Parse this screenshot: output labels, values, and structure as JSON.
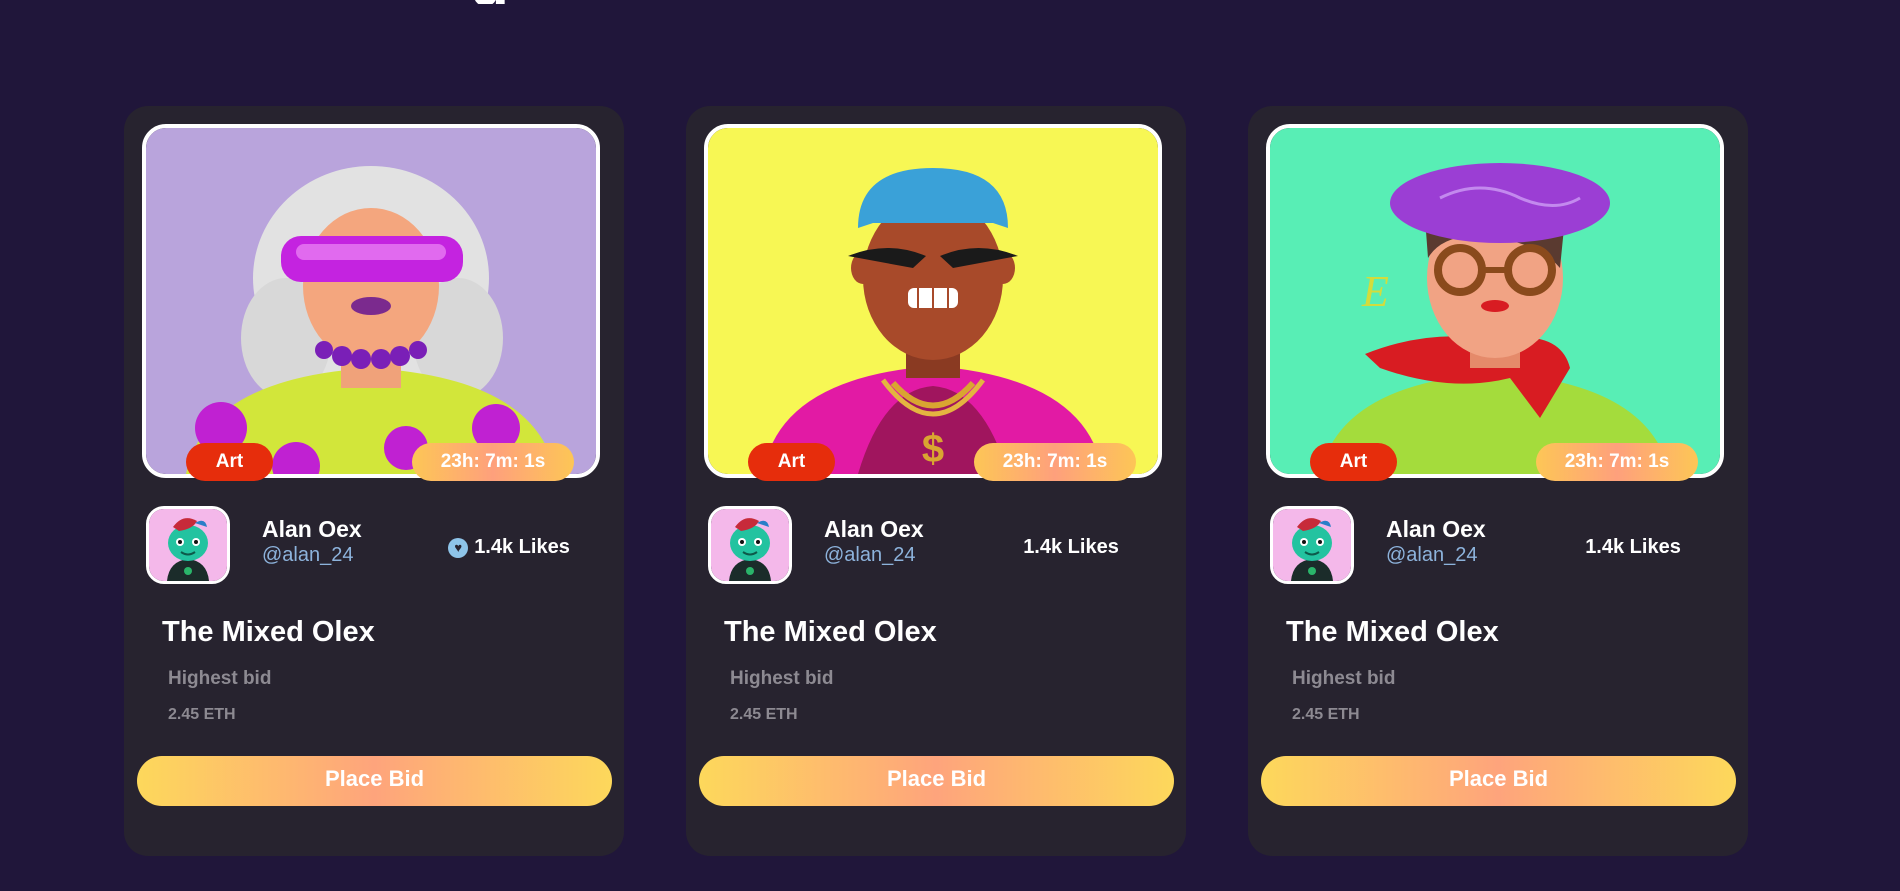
{
  "header": {
    "title_fragment": "g"
  },
  "colors": {
    "page_background": "#20163a",
    "card_background": "#27232f",
    "category_pill": "#e62d0c",
    "gradient_start": "#fdd85b",
    "gradient_mid": "#fea47c",
    "handle_text": "#8db3dc",
    "muted_text": "#8d8a92"
  },
  "cards": [
    {
      "category": "Art",
      "timer": "23h: 7m: 1s",
      "artwork": "silver-hair-visor-woman-portrait",
      "creator_name": "Alan Oex",
      "creator_handle": "@alan_24",
      "likes_icon": "heart-icon",
      "likes": "1.4k Likes",
      "title": "The Mixed Olex",
      "bid_label": "Highest bid",
      "bid_value": "2.45 ETH",
      "button_label": "Place Bid"
    },
    {
      "category": "Art",
      "timer": "23h: 7m: 1s",
      "artwork": "blue-hair-gold-chain-portrait",
      "creator_name": "Alan Oex",
      "creator_handle": "@alan_24",
      "likes": "1.4k Likes",
      "title": "The Mixed Olex",
      "bid_label": "Highest bid",
      "bid_value": "2.45 ETH",
      "button_label": "Place Bid"
    },
    {
      "category": "Art",
      "timer": "23h: 7m: 1s",
      "artwork": "purple-beret-red-scarf-portrait",
      "creator_name": "Alan Oex",
      "creator_handle": "@alan_24",
      "likes": "1.4k Likes",
      "title": "The Mixed Olex",
      "bid_label": "Highest bid",
      "bid_value": "2.45 ETH",
      "button_label": "Place Bid"
    }
  ]
}
